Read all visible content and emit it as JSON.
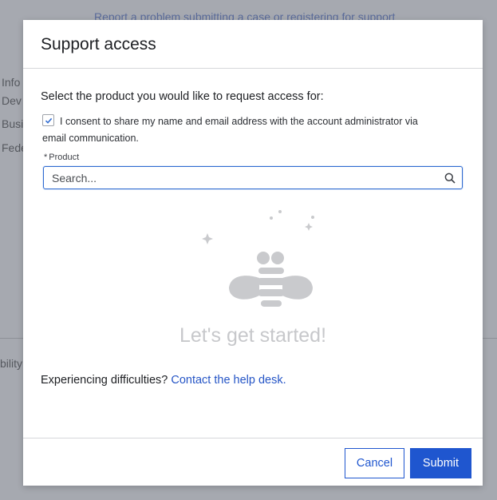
{
  "background": {
    "link_text": "Report a problem submitting a case or registering for support",
    "side_items": [
      "Info",
      "Dev",
      "Busi",
      "Fede"
    ],
    "side_text_lower": "bility"
  },
  "modal": {
    "title": "Support access",
    "prompt": "Select the product you would like to request access for:",
    "consent": {
      "checked": true,
      "text": "I consent to share my name and email address with the account administrator via email communication."
    },
    "product_field": {
      "required_marker": "*",
      "label": "Product",
      "placeholder": "Search...",
      "value": ""
    },
    "empty_state": {
      "illustration": "bee-icon",
      "message": "Let's get started!"
    },
    "help": {
      "text": "Experiencing difficulties?",
      "link_text": "Contact the help desk."
    },
    "buttons": {
      "cancel": "Cancel",
      "submit": "Submit"
    }
  },
  "colors": {
    "primary": "#1f56cf",
    "overlay": "#a6a9b0"
  }
}
